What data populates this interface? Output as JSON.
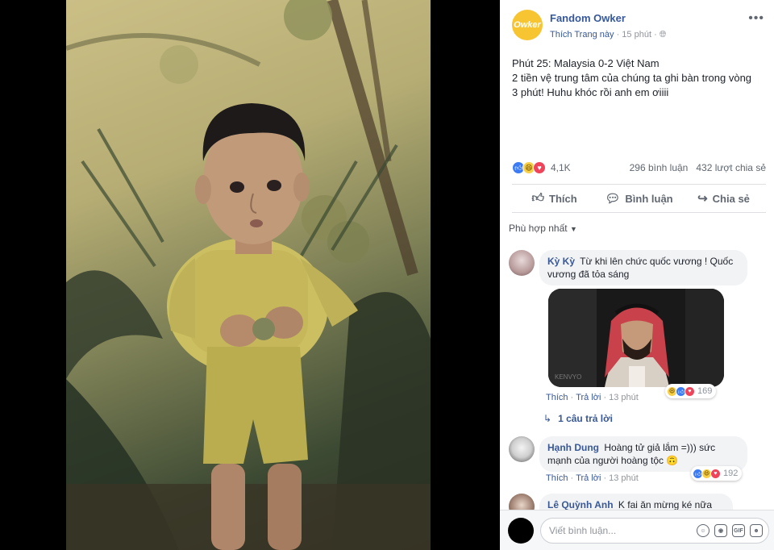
{
  "post": {
    "page_name": "Fandom Owker",
    "logo_text": "Owker",
    "like_page": "Thích Trang này",
    "dot": "·",
    "time": "15 phút",
    "text_lines": [
      "Phút 25: Malaysia 0-2 Việt Nam",
      "2 tiền vệ trung tâm của chúng ta ghi bàn trong vòng",
      "3 phút! Huhu khóc rồi anh em ơiiii"
    ],
    "reaction_count": "4,1K",
    "comments_count": "296 bình luận",
    "shares_count": "432 lượt chia sẻ"
  },
  "actions": {
    "like": "Thích",
    "comment": "Bình luận",
    "share": "Chia sẻ"
  },
  "sort_label": "Phù hợp nhất",
  "comments": [
    {
      "author": "Kỳ Kỳ",
      "line1": "Từ khi lên chức quốc vương ! Quốc",
      "line2": "vương đã tỏa sáng",
      "like": "Thích",
      "reply": "Trả lời",
      "time": "13 phút",
      "reactions": "169",
      "image_watermark": "KENVYO",
      "replies": "1 câu trả lời"
    },
    {
      "author": "Hạnh Dung",
      "line1": "Hoàng tử giả lắm =))) sức",
      "line2": "mạnh của người hoàng tộc 🙃",
      "like": "Thích",
      "reply": "Trả lời",
      "time": "13 phút",
      "reactions": "192"
    },
    {
      "author": "Lê Quỳnh Anh",
      "line1": "K fai ăn mừng ké nữa rồi"
    }
  ],
  "composer": {
    "placeholder": "Viết bình luận...",
    "gif_label": "GIF"
  },
  "colors": {
    "link_blue": "#365899",
    "like_blue": "#3b7cf5",
    "love_red": "#f0445a",
    "haha_yellow": "#f8d048",
    "page_logo": "#f7c531"
  }
}
